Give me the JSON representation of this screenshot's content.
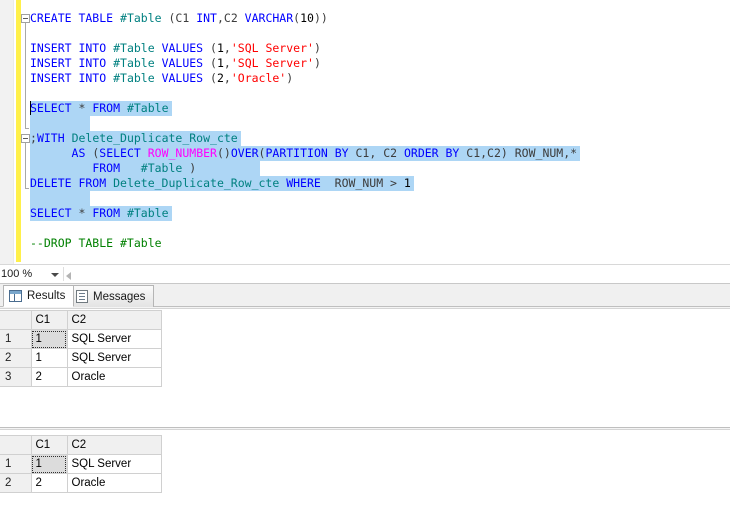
{
  "editor": {
    "zoom_level": "100 %",
    "lines": [
      {
        "id": "line-create-table",
        "outline": "collapse",
        "selected": false,
        "tokens": [
          {
            "cls": "kw",
            "t": "CREATE TABLE "
          },
          {
            "cls": "tbl",
            "t": "#Table"
          },
          {
            "cls": "pun",
            "t": " (C1 "
          },
          {
            "cls": "kw",
            "t": "INT"
          },
          {
            "cls": "pun",
            "t": ",C2 "
          },
          {
            "cls": "kw",
            "t": "VARCHAR"
          },
          {
            "cls": "pun",
            "t": "("
          },
          {
            "cls": "num",
            "t": "10"
          },
          {
            "cls": "pun",
            "t": "))"
          }
        ]
      },
      {
        "id": "line-blank-1",
        "outline": "stem",
        "selected": false,
        "tokens": []
      },
      {
        "id": "line-insert-1",
        "outline": "stem",
        "selected": false,
        "tokens": [
          {
            "cls": "kw",
            "t": "INSERT INTO "
          },
          {
            "cls": "tbl",
            "t": "#Table"
          },
          {
            "cls": "kw",
            "t": " VALUES"
          },
          {
            "cls": "pun",
            "t": " ("
          },
          {
            "cls": "num",
            "t": "1"
          },
          {
            "cls": "pun",
            "t": ","
          },
          {
            "cls": "str",
            "t": "'SQL Server'"
          },
          {
            "cls": "pun",
            "t": ")"
          }
        ]
      },
      {
        "id": "line-insert-2",
        "outline": "stem",
        "selected": false,
        "tokens": [
          {
            "cls": "kw",
            "t": "INSERT INTO "
          },
          {
            "cls": "tbl",
            "t": "#Table"
          },
          {
            "cls": "kw",
            "t": " VALUES"
          },
          {
            "cls": "pun",
            "t": " ("
          },
          {
            "cls": "num",
            "t": "1"
          },
          {
            "cls": "pun",
            "t": ","
          },
          {
            "cls": "str",
            "t": "'SQL Server'"
          },
          {
            "cls": "pun",
            "t": ")"
          }
        ]
      },
      {
        "id": "line-insert-3",
        "outline": "stem",
        "selected": false,
        "tokens": [
          {
            "cls": "kw",
            "t": "INSERT INTO "
          },
          {
            "cls": "tbl",
            "t": "#Table"
          },
          {
            "cls": "kw",
            "t": " VALUES"
          },
          {
            "cls": "pun",
            "t": " ("
          },
          {
            "cls": "num",
            "t": "2"
          },
          {
            "cls": "pun",
            "t": ","
          },
          {
            "cls": "str",
            "t": "'Oracle'"
          },
          {
            "cls": "pun",
            "t": ")"
          }
        ]
      },
      {
        "id": "line-blank-2",
        "outline": "stem",
        "selected": false,
        "tokens": []
      },
      {
        "id": "line-select-1",
        "outline": "stem",
        "selected": true,
        "caret": true,
        "tokens": [
          {
            "cls": "kw",
            "t": "SELECT "
          },
          {
            "cls": "pun",
            "t": "* "
          },
          {
            "cls": "kw",
            "t": "FROM "
          },
          {
            "cls": "tbl",
            "t": "#Table"
          }
        ]
      },
      {
        "id": "line-blank-3",
        "outline": "stemend",
        "selected": true,
        "sel_width": 60,
        "tokens": []
      },
      {
        "id": "line-with-cte",
        "outline": "collapse2",
        "selected": true,
        "tokens": [
          {
            "cls": "pun",
            "t": ";"
          },
          {
            "cls": "kw",
            "t": "WITH "
          },
          {
            "cls": "tbl",
            "t": "Delete_Duplicate_Row_cte"
          }
        ]
      },
      {
        "id": "line-cte-as",
        "outline": "stem2",
        "selected": true,
        "tokens": [
          {
            "cls": "plain",
            "t": "      "
          },
          {
            "cls": "kw",
            "t": "AS "
          },
          {
            "cls": "pun",
            "t": "("
          },
          {
            "cls": "kw",
            "t": "SELECT "
          },
          {
            "cls": "fn",
            "t": "ROW_NUMBER"
          },
          {
            "cls": "pun",
            "t": "()"
          },
          {
            "cls": "kw",
            "t": "OVER"
          },
          {
            "cls": "pun",
            "t": "("
          },
          {
            "cls": "kw",
            "t": "PARTITION BY "
          },
          {
            "cls": "pun",
            "t": "C1, C2 "
          },
          {
            "cls": "kw",
            "t": "ORDER BY "
          },
          {
            "cls": "pun",
            "t": "C1,C2) ROW_NUM,*"
          }
        ]
      },
      {
        "id": "line-cte-from",
        "outline": "stem2",
        "selected": true,
        "sel_width": 230,
        "tokens": [
          {
            "cls": "plain",
            "t": "         "
          },
          {
            "cls": "kw",
            "t": "FROM   "
          },
          {
            "cls": "tbl",
            "t": "#Table"
          },
          {
            "cls": "pun",
            "t": " )"
          }
        ]
      },
      {
        "id": "line-delete-cte",
        "outline": "stem2end",
        "selected": true,
        "tokens": [
          {
            "cls": "kw",
            "t": "DELETE FROM "
          },
          {
            "cls": "tbl",
            "t": "Delete_Duplicate_Row_cte"
          },
          {
            "cls": "kw",
            "t": " WHERE  "
          },
          {
            "cls": "pun",
            "t": "ROW_NUM "
          },
          {
            "cls": "pun",
            "t": "> "
          },
          {
            "cls": "num",
            "t": "1"
          }
        ]
      },
      {
        "id": "line-blank-4",
        "outline": "none",
        "selected": true,
        "sel_width": 60,
        "tokens": []
      },
      {
        "id": "line-select-2",
        "outline": "none",
        "selected": true,
        "tokens": [
          {
            "cls": "kw",
            "t": "SELECT "
          },
          {
            "cls": "pun",
            "t": "* "
          },
          {
            "cls": "kw",
            "t": "FROM "
          },
          {
            "cls": "tbl",
            "t": "#Table"
          }
        ]
      },
      {
        "id": "line-blank-5",
        "outline": "none",
        "selected": false,
        "tokens": []
      },
      {
        "id": "line-drop-comment",
        "outline": "none",
        "selected": false,
        "tokens": [
          {
            "cls": "cmt",
            "t": "--DROP TABLE #Table"
          }
        ]
      }
    ]
  },
  "results": {
    "tabs": [
      {
        "label": "Results",
        "icon": "grid-icon",
        "active": true
      },
      {
        "label": "Messages",
        "icon": "messages-icon",
        "active": false
      }
    ],
    "grids": [
      {
        "id": "result-grid-1",
        "headers": [
          "C1",
          "C2"
        ],
        "rows": [
          {
            "num": "1",
            "c1": "1",
            "c2": "SQL Server",
            "focused": true
          },
          {
            "num": "2",
            "c1": "1",
            "c2": "SQL Server",
            "focused": false
          },
          {
            "num": "3",
            "c1": "2",
            "c2": "Oracle",
            "focused": false
          }
        ]
      },
      {
        "id": "result-grid-2",
        "headers": [
          "C1",
          "C2"
        ],
        "rows": [
          {
            "num": "1",
            "c1": "1",
            "c2": "SQL Server",
            "focused": true
          },
          {
            "num": "2",
            "c1": "2",
            "c2": "Oracle",
            "focused": false
          }
        ]
      }
    ]
  },
  "colors": {
    "keyword": "#0000ff",
    "table_identifier": "#008080",
    "string_literal": "#ff0000",
    "function": "#ff00ff",
    "comment": "#008000",
    "selection": "#add6f5",
    "change_bar": "#fff04a"
  }
}
